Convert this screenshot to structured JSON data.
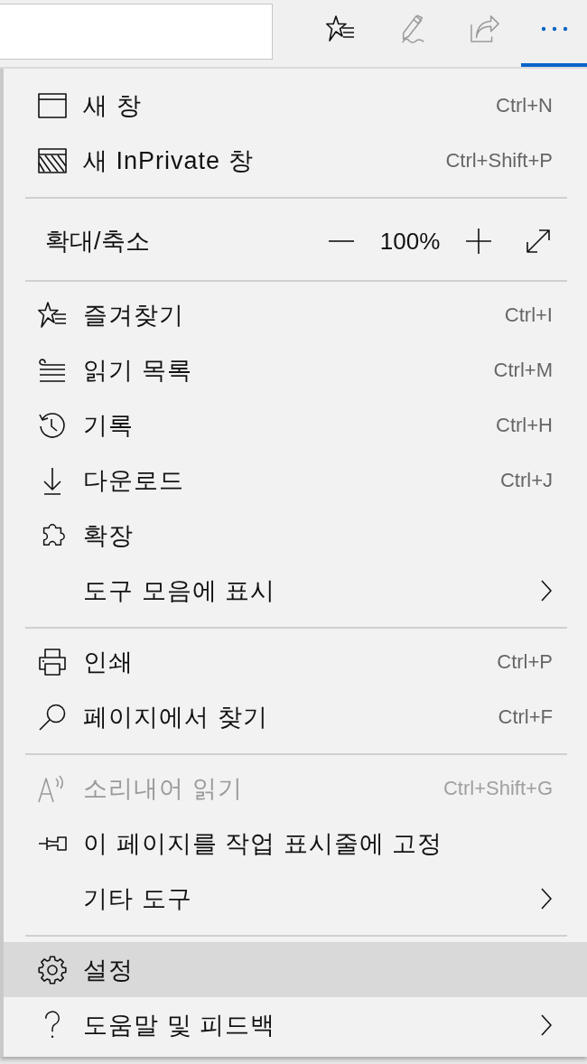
{
  "toolbar": {
    "buttons": [
      {
        "selected": false,
        "disabled": false
      },
      {
        "selected": false,
        "disabled": true
      },
      {
        "selected": false,
        "disabled": true
      },
      {
        "selected": true,
        "disabled": false
      }
    ]
  },
  "menu": {
    "sections": [
      {
        "items": [
          {
            "kind": "command",
            "label": "새 창",
            "shortcut": "Ctrl+N",
            "selected": false,
            "disabled": false
          },
          {
            "kind": "command",
            "label": "새 InPrivate 창",
            "shortcut": "Ctrl+Shift+P",
            "selected": false,
            "disabled": false
          }
        ]
      },
      {
        "items": [
          {
            "kind": "zoom",
            "label": "확대/축소",
            "zoom_level": "100%"
          }
        ]
      },
      {
        "items": [
          {
            "kind": "command",
            "label": "즐겨찾기",
            "shortcut": "Ctrl+I",
            "selected": false,
            "disabled": false
          },
          {
            "kind": "command",
            "label": "읽기 목록",
            "shortcut": "Ctrl+M",
            "selected": false,
            "disabled": false
          },
          {
            "kind": "command",
            "label": "기록",
            "shortcut": "Ctrl+H",
            "selected": false,
            "disabled": false
          },
          {
            "kind": "command",
            "label": "다운로드",
            "shortcut": "Ctrl+J",
            "selected": false,
            "disabled": false
          },
          {
            "kind": "command",
            "label": "확장",
            "selected": false,
            "disabled": false
          },
          {
            "kind": "submenu",
            "label": "도구 모음에 표시",
            "selected": false,
            "disabled": false
          }
        ]
      },
      {
        "items": [
          {
            "kind": "command",
            "label": "인쇄",
            "shortcut": "Ctrl+P",
            "selected": false,
            "disabled": false
          },
          {
            "kind": "command",
            "label": "페이지에서 찾기",
            "shortcut": "Ctrl+F",
            "selected": false,
            "disabled": false
          }
        ]
      },
      {
        "items": [
          {
            "kind": "command",
            "label": "소리내어 읽기",
            "shortcut": "Ctrl+Shift+G",
            "selected": false,
            "disabled": true
          },
          {
            "kind": "command",
            "label": "이 페이지를 작업 표시줄에 고정",
            "selected": false,
            "disabled": false
          },
          {
            "kind": "submenu",
            "label": "기타 도구",
            "selected": false,
            "disabled": false
          }
        ]
      },
      {
        "items": [
          {
            "kind": "command",
            "label": "설정",
            "selected": true,
            "disabled": false
          },
          {
            "kind": "submenu",
            "label": "도움말 및 피드백",
            "selected": false,
            "disabled": false
          }
        ]
      }
    ]
  }
}
